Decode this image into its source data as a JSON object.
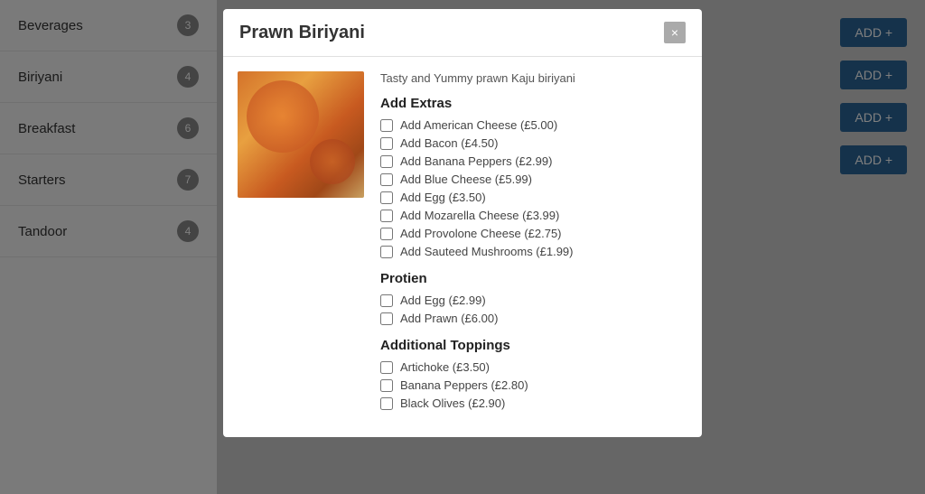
{
  "sidebar": {
    "items": [
      {
        "label": "Beverages",
        "badge": "3"
      },
      {
        "label": "Biriyani",
        "badge": "4"
      },
      {
        "label": "Breakfast",
        "badge": "6"
      },
      {
        "label": "Starters",
        "badge": "7"
      },
      {
        "label": "Tandoor",
        "badge": "4"
      }
    ]
  },
  "add_buttons": [
    "ADD +",
    "ADD +",
    "ADD +",
    "ADD +"
  ],
  "modal": {
    "title": "Prawn Biriyani",
    "close_label": "×",
    "description": "Tasty and Yummy prawn Kaju biriyani",
    "sections": [
      {
        "title": "Add Extras",
        "items": [
          "Add American Cheese (£5.00)",
          "Add Bacon (£4.50)",
          "Add Banana Peppers (£2.99)",
          "Add Blue Cheese (£5.99)",
          "Add Egg (£3.50)",
          "Add Mozarella Cheese (£3.99)",
          "Add Provolone Cheese (£2.75)",
          "Add Sauteed Mushrooms (£1.99)"
        ]
      },
      {
        "title": "Protien",
        "items": [
          "Add Egg (£2.99)",
          "Add Prawn (£6.00)"
        ]
      },
      {
        "title": "Additional Toppings",
        "items": [
          "Artichoke (£3.50)",
          "Banana Peppers (£2.80)",
          "Black Olives (£2.90)"
        ]
      }
    ]
  }
}
